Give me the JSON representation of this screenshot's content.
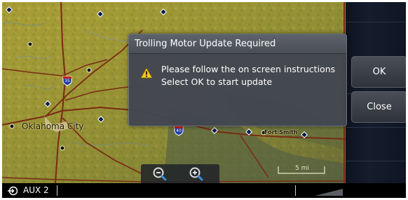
{
  "dialog": {
    "title": "Trolling Motor Update Required",
    "message_line1": "Please follow the on screen instructions",
    "message_line2": "Select OK to start update",
    "icon": "warning-icon",
    "ok_label": "OK",
    "close_label": "Close"
  },
  "map": {
    "labels": {
      "oklahoma_city": "Oklahoma City",
      "fort_smith": "Fort Smith"
    },
    "highway_shields": {
      "i35": "35",
      "i40": "40"
    },
    "scale_label": "5 mi",
    "zoom_out_icon": "zoom-out-icon",
    "zoom_in_icon": "zoom-in-icon"
  },
  "status_bar": {
    "source_icon": "input-source-icon",
    "source_label": "AUX 2"
  },
  "colors": {
    "map_terrain": "#a49a32",
    "dialog_bg": "#42464f",
    "status_bar": "#000000",
    "button_text": "#ffffff"
  }
}
